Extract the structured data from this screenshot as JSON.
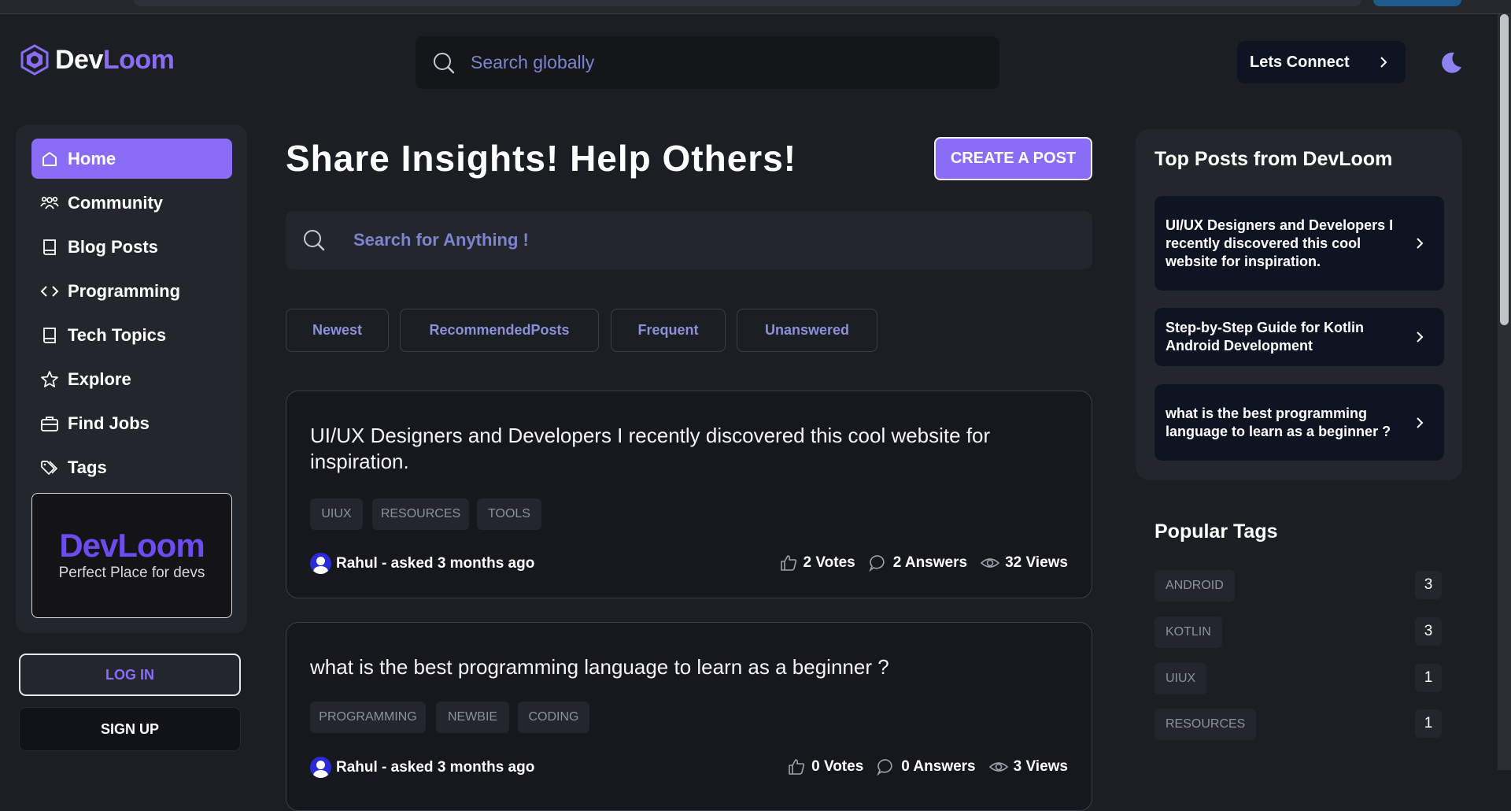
{
  "brand": {
    "name_a": "Dev",
    "name_b": "Loom"
  },
  "header": {
    "search_placeholder": "Search globally",
    "connect_label": "Lets Connect"
  },
  "sidebar": {
    "items": [
      {
        "label": "Home",
        "icon": "home-icon"
      },
      {
        "label": "Community",
        "icon": "community-icon"
      },
      {
        "label": "Blog Posts",
        "icon": "book-icon"
      },
      {
        "label": "Programming",
        "icon": "code-icon"
      },
      {
        "label": "Tech Topics",
        "icon": "book-icon"
      },
      {
        "label": "Explore",
        "icon": "star-icon"
      },
      {
        "label": "Find Jobs",
        "icon": "briefcase-icon"
      },
      {
        "label": "Tags",
        "icon": "tags-icon"
      }
    ],
    "promo_title": "DevLoom",
    "promo_subtitle": "Perfect Place for devs",
    "login_label": "LOG IN",
    "signup_label": "SIGN UP"
  },
  "main": {
    "heading": "Share Insights! Help Others!",
    "create_label": "CREATE A POST",
    "search_placeholder": "Search for Anything !",
    "filters": [
      "Newest",
      "RecommendedPosts",
      "Frequent",
      "Unanswered"
    ],
    "posts": [
      {
        "title": "UI/UX Designers and Developers I recently discovered this cool website for inspiration.",
        "tags": [
          "UIUX",
          "RESOURCES",
          "TOOLS"
        ],
        "author": "Rahul - asked 3 months ago",
        "votes": "2 Votes",
        "answers": "2 Answers",
        "views": "32 Views"
      },
      {
        "title": "what is the best programming language to learn as a beginner ?",
        "tags": [
          "PROGRAMMING",
          "NEWBIE",
          "CODING"
        ],
        "author": "Rahul - asked 3 months ago",
        "votes": "0 Votes",
        "answers": "0 Answers",
        "views": "3 Views"
      }
    ]
  },
  "right": {
    "top_title": "Top Posts from DevLoom",
    "top_posts": [
      "UI/UX Designers and Developers I recently discovered this cool website for inspiration.",
      "Step-by-Step Guide for Kotlin Android Development",
      "what is the best programming language to learn as a beginner ?"
    ],
    "popular_title": "Popular Tags",
    "popular_tags": [
      {
        "name": "ANDROID",
        "count": "3"
      },
      {
        "name": "KOTLIN",
        "count": "3"
      },
      {
        "name": "UIUX",
        "count": "1"
      },
      {
        "name": "RESOURCES",
        "count": "1"
      }
    ]
  },
  "colors": {
    "accent": "#8b6cf6",
    "background": "#1b1e23",
    "panel": "#23262c"
  }
}
